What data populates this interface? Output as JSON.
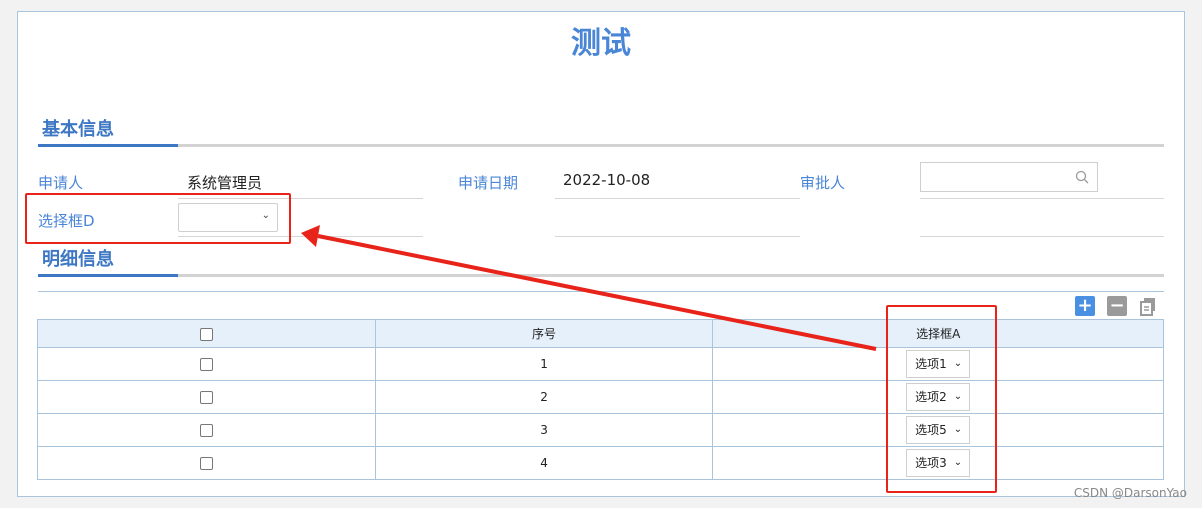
{
  "form": {
    "title": "测试",
    "basic_section": "基本信息",
    "detail_section": "明细信息",
    "applicant_label": "申请人",
    "applicant_value": "系统管理员",
    "apply_date_label": "申请日期",
    "apply_date_value": "2022-10-08",
    "approver_label": "审批人",
    "approver_value": "",
    "select_d_label": "选择框D",
    "select_d_value": ""
  },
  "toolbar": {
    "add_icon": "plus-icon",
    "remove_icon": "minus-icon",
    "copy_icon": "copy-icon"
  },
  "table": {
    "columns": [
      "",
      "序号",
      "选择框A"
    ],
    "rows": [
      {
        "index": "1",
        "select_a": "选项1"
      },
      {
        "index": "2",
        "select_a": "选项2"
      },
      {
        "index": "3",
        "select_a": "选项5"
      },
      {
        "index": "4",
        "select_a": "选项3"
      }
    ]
  },
  "watermark": "CSDN @DarsonYao",
  "colors": {
    "accent": "#4a86d6",
    "annotation": "#e8241a",
    "add_button": "#4a90e2",
    "gray_button": "#9a9a9a"
  }
}
